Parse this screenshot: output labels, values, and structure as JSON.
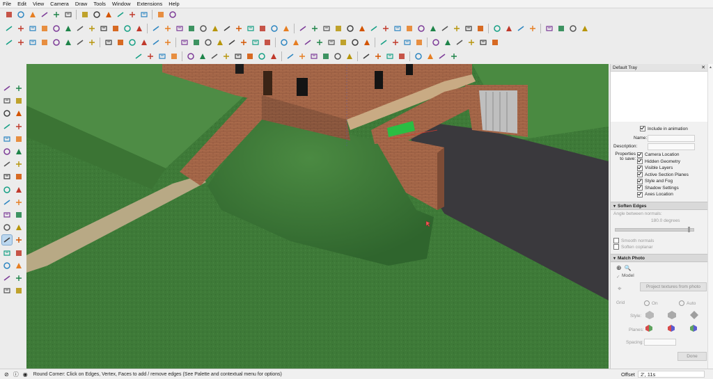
{
  "menu": [
    "File",
    "Edit",
    "View",
    "Camera",
    "Draw",
    "Tools",
    "Window",
    "Extensions",
    "Help"
  ],
  "toolbar_icons": {
    "row1": [
      "get-models-icon",
      "share-model-icon",
      "components-icon",
      "3d-warehouse-icon",
      "extension-warehouse-icon",
      "layout-icon",
      "solid-union-icon",
      "solid-subtract-icon",
      "solid-trim-icon",
      "solid-intersect-icon",
      "solid-split-icon",
      "outer-shell-icon",
      "sun-icon",
      "wrench-icon"
    ],
    "row2_count": 48,
    "row3_count": 40,
    "row4_count": 26
  },
  "left_tools": [
    "select-icon",
    "eraser-icon",
    "paint-bucket-icon",
    "pencil-icon",
    "line-icon",
    "freehand-icon",
    "rectangle-icon",
    "rotated-rect-icon",
    "circle-icon",
    "polygon-icon",
    "arc-icon",
    "pie-icon",
    "move-icon",
    "push-pull-icon",
    "rotate-icon",
    "follow-me-icon",
    "scale-icon",
    "offset-icon",
    "tape-measure-icon",
    "dimension-icon",
    "protractor-icon",
    "text-icon",
    "axes-icon",
    "3d-text-icon",
    "orbit-icon",
    "pan-icon",
    "zoom-icon",
    "zoom-window-icon",
    "zoom-extents-icon",
    "previous-view-icon",
    "position-camera-icon",
    "look-around-icon",
    "walk-icon",
    "section-plane-icon"
  ],
  "tray": {
    "title": "Default Tray",
    "include_in_animation": "Include in animation",
    "name_label": "Name:",
    "description_label": "Description:",
    "properties_label_1": "Properties",
    "properties_label_2": "to save:",
    "properties": [
      "Camera Location",
      "Hidden Geometry",
      "Visible Layers",
      "Active Section Planes",
      "Style and Fog",
      "Shadow Settings",
      "Axes Location"
    ],
    "soften_edges": {
      "title": "Soften Edges",
      "angle_label": "Angle between normals:",
      "angle_value": "180.0  degrees",
      "angle_fraction": 0.95,
      "smooth_normals": "Smooth normals",
      "soften_coplanar": "Soften coplanar"
    },
    "match_photo": {
      "title": "Match Photo",
      "model_label": "Model",
      "project_button": "Project textures from photo",
      "grid_label": "Grid",
      "grid_on": "On",
      "grid_auto": "Auto",
      "style_label": "Style:",
      "planes_label": "Planes:",
      "spacing_label": "Spacing:",
      "done_button": "Done"
    }
  },
  "status": {
    "message": "Round Corner: Click on Edges, Vertex, Faces to add / remove edges (See Palette and contextual menu for options)",
    "offset_label": "Offset",
    "offset_value": "2', 11s"
  },
  "colors": {
    "grass": "#3f7d3a",
    "brick": "#a8694a",
    "asphalt": "#3a393d",
    "path": "#b8a985",
    "toolbar": "#ececec"
  }
}
